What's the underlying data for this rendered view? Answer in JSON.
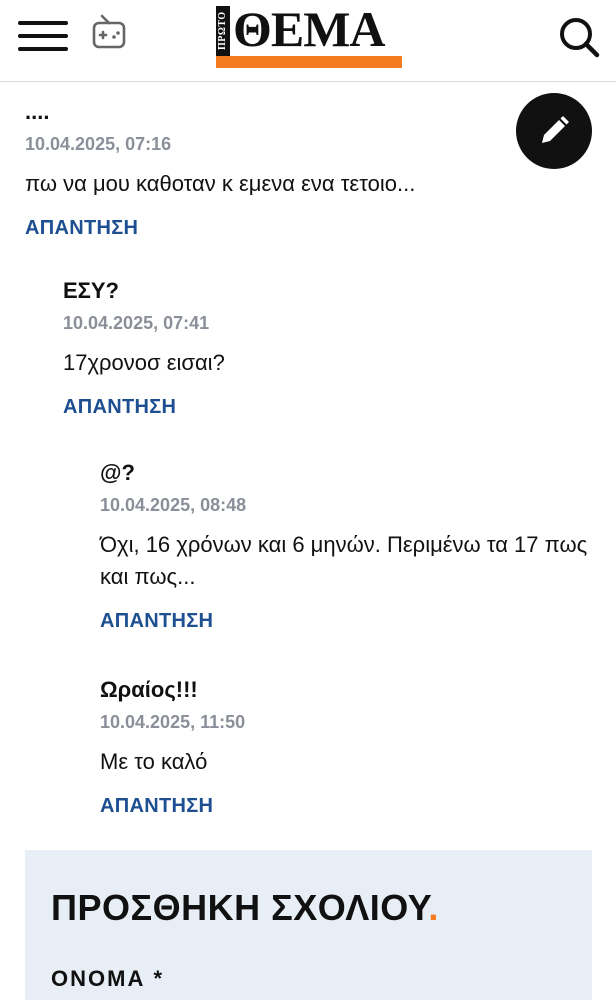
{
  "header": {
    "logo_prefix": "ΠΡΩΤΟ",
    "logo_text": "ΘΕΜΑ",
    "brand_color": "#f47b20",
    "icons": [
      "menu-icon",
      "gamepad-icon",
      "search-icon"
    ]
  },
  "fab": {
    "icon": "pencil-icon"
  },
  "comments": [
    {
      "author": "....",
      "date": "10.04.2025, 07:16",
      "text": "πω να μου καθοταν κ εμενα ενα τετοιο...",
      "reply": "ΑΠΑΝΤΗΣΗ"
    },
    {
      "author": "ΕΣΥ?",
      "date": "10.04.2025, 07:41",
      "text": "17χρονοσ εισαι?",
      "reply": "ΑΠΑΝΤΗΣΗ"
    },
    {
      "author": "@?",
      "date": "10.04.2025, 08:48",
      "text": "Όχι, 16 χρόνων και 6 μηνών. Περιμένω τα 17 πως και πως...",
      "reply": "ΑΠΑΝΤΗΣΗ"
    },
    {
      "author": "Ωραίος!!!",
      "date": "10.04.2025, 11:50",
      "text": "Με το καλό",
      "reply": "ΑΠΑΝΤΗΣΗ"
    }
  ],
  "add_comment": {
    "title": "ΠΡΟΣΘΗΚΗ ΣΧΟΛΙΟΥ",
    "title_dot": ".",
    "name_label": "ΟΝΟΜΑ *"
  },
  "colors": {
    "reply_link": "#1d4f91",
    "date_text": "#8a8f99",
    "form_bg": "#e8eef5"
  }
}
